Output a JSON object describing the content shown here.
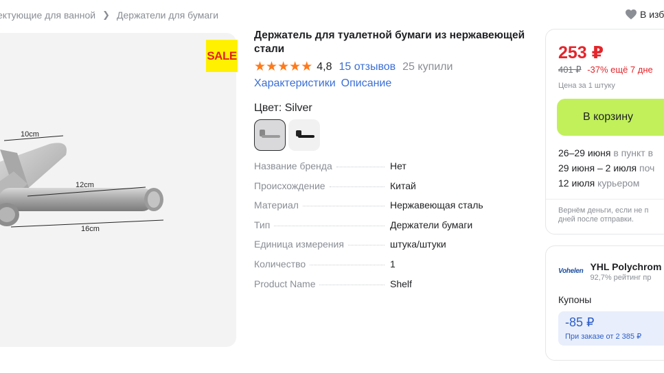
{
  "breadcrumb": {
    "items": [
      "ектующие для ванной",
      "Держатели для бумаги"
    ]
  },
  "favorite": {
    "label": "В изб",
    "icon": "heart-icon"
  },
  "gallery": {
    "sale_badge": "SALE",
    "dimensions": {
      "a": "10cm",
      "b": "12cm",
      "c": "16cm"
    }
  },
  "product": {
    "title": "Держатель для туалетной бумаги из нержавеющей стали",
    "rating": "4,8",
    "reviews": "15 отзывов",
    "bought": "25 купили",
    "tabs": [
      "Характеристики",
      "Описание"
    ],
    "color_label": "Цвет: Silver",
    "specs": [
      {
        "key": "Название бренда",
        "value": "Нет"
      },
      {
        "key": "Происхождение",
        "value": "Китай"
      },
      {
        "key": "Материал",
        "value": "Нержавеющая сталь"
      },
      {
        "key": "Тип",
        "value": "Держатели бумаги"
      },
      {
        "key": "Единица измерения",
        "value": "штука/штуки"
      },
      {
        "key": "Количество",
        "value": "1"
      },
      {
        "key": "Product Name",
        "value": "Shelf"
      }
    ]
  },
  "buy_box": {
    "price": "253 ₽",
    "old_price": "401 ₽",
    "discount": "-37% ещё 7 дне",
    "unit": "Цена за 1 штуку",
    "cart_button": "В корзину",
    "delivery": [
      {
        "date": "26–29 июня",
        "detail": " в пункт в"
      },
      {
        "date": "29 июня – 2 июля",
        "detail": " поч"
      },
      {
        "date": "12 июля",
        "detail": " курьером"
      }
    ],
    "refund_line1": "Вернём деньги, если не п",
    "refund_line2": "дней после отправки."
  },
  "seller": {
    "logo_text": "Vohelen",
    "name": "YHL Polychrom",
    "sub": "92,7% рейтинг пр",
    "coupons_label": "Купоны",
    "coupon_value": "-85 ₽",
    "coupon_condition": "При заказе от 2 385 ₽"
  },
  "colors": {
    "accent_red": "#e4252b",
    "link_blue": "#3a6fd6",
    "cart_green": "#c1f05a",
    "star_orange": "#ff7a1a"
  }
}
